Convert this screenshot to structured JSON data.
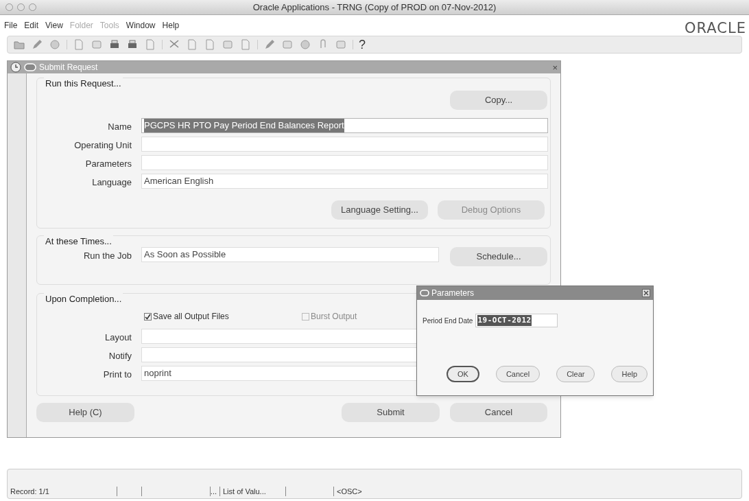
{
  "window": {
    "title": "Oracle Applications - TRNG (Copy of PROD on 07-Nov-2012)"
  },
  "menu": [
    "File",
    "Edit",
    "View",
    "Folder",
    "Tools",
    "Window",
    "Help"
  ],
  "menu_disabled": [
    false,
    false,
    false,
    true,
    true,
    false,
    false
  ],
  "logo": "ORACLE",
  "toolbar": {
    "help_glyph": "?"
  },
  "submit_request": {
    "title": "Submit Request",
    "close_glyph": "×",
    "run_group": {
      "title": "Run this Request...",
      "copy_button": "Copy...",
      "fields": [
        {
          "label": "Name",
          "value": "PGCPS HR PTO Pay Period End Balances Report",
          "selected": true
        },
        {
          "label": "Operating Unit",
          "selected": false
        },
        {
          "label": "Parameters",
          "selected": false
        },
        {
          "label": "Language",
          "value": "American English",
          "selected": false
        }
      ],
      "buttons": [
        {
          "label": "Language Setting...",
          "disabled": false
        },
        {
          "label": "Debug Options",
          "disabled": true
        }
      ]
    },
    "times_group": {
      "title": "At these Times...",
      "label": "Run the Job",
      "value": "As Soon as Possible",
      "button": "Schedule..."
    },
    "completion_group": {
      "title": "Upon Completion...",
      "checkboxes": [
        {
          "label": "Save all Output Files",
          "checked": true,
          "disabled": false
        },
        {
          "label": "Burst Output",
          "checked": false,
          "disabled": true
        }
      ],
      "fields": [
        {
          "label": "Layout"
        },
        {
          "label": "Notify"
        },
        {
          "label": "Print to",
          "value": "noprint"
        }
      ]
    },
    "buttons": [
      {
        "label": "Help (C)"
      },
      {
        "label": "Submit"
      },
      {
        "label": "Cancel"
      }
    ]
  },
  "parameters_dialog": {
    "title": "Parameters",
    "field_label": "Period End Date",
    "field_value": "19-OCT-2012",
    "buttons": [
      {
        "label": "OK",
        "selected": true
      },
      {
        "label": "Cancel",
        "selected": false
      },
      {
        "label": "Clear",
        "selected": false
      },
      {
        "label": "Help",
        "selected": false
      }
    ]
  },
  "status_bar": [
    "Record: 1/1",
    "...",
    "List of Valu...",
    "<OSC>"
  ]
}
